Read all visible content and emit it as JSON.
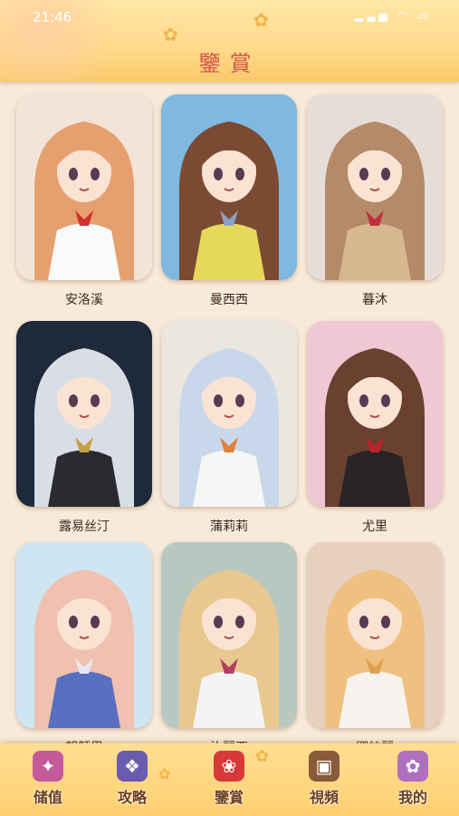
{
  "status": {
    "time": "21:46",
    "icons": "▂▃▅ ◠ ▭"
  },
  "header": {
    "title": "鑒賞"
  },
  "gallery": [
    {
      "name": "安洛溪",
      "hair": "#e6a070",
      "bg": "#f3e4d8",
      "outfit": "#fafafa",
      "accent": "#d03030"
    },
    {
      "name": "曼西西",
      "hair": "#7a4a32",
      "bg": "#7fb8e0",
      "outfit": "#e6d85a",
      "accent": "#8aa0c8"
    },
    {
      "name": "暮沐",
      "hair": "#b48a68",
      "bg": "#e6dcd8",
      "outfit": "#d8b890",
      "accent": "#c03040"
    },
    {
      "name": "露易丝汀",
      "hair": "#d8dde6",
      "bg": "#1e2a3a",
      "outfit": "#2a2a30",
      "accent": "#c8a040"
    },
    {
      "name": "蒲莉莉",
      "hair": "#c8d8ea",
      "bg": "#ece6e0",
      "outfit": "#f6f6f6",
      "accent": "#e0803a"
    },
    {
      "name": "尤里",
      "hair": "#6a4030",
      "bg": "#f0c8d4",
      "outfit": "#2a2426",
      "accent": "#c02030"
    },
    {
      "name": "朝顏里",
      "hair": "#f0c0b0",
      "bg": "#cfe6f2",
      "outfit": "#5870c0",
      "accent": "#e8e8f4"
    },
    {
      "name": "汝麗西",
      "hair": "#e8c890",
      "bg": "#b8c8c0",
      "outfit": "#f4f4f4",
      "accent": "#b04060"
    },
    {
      "name": "卿絲麗",
      "hair": "#f0c080",
      "bg": "#e8d0c0",
      "outfit": "#f8f2ee",
      "accent": "#e0a050"
    }
  ],
  "nav": [
    {
      "label": "储值",
      "icon": "gift-icon",
      "glyph": "✦",
      "color": "#c45a9a"
    },
    {
      "label": "攻略",
      "icon": "book-icon",
      "glyph": "❖",
      "color": "#6a5ab0"
    },
    {
      "label": "鑒賞",
      "icon": "rose-icon",
      "glyph": "❀",
      "color": "#d83838"
    },
    {
      "label": "視頻",
      "icon": "film-icon",
      "glyph": "▣",
      "color": "#8a5a3a"
    },
    {
      "label": "我的",
      "icon": "profile-card-icon",
      "glyph": "✿",
      "color": "#b070c0"
    }
  ]
}
